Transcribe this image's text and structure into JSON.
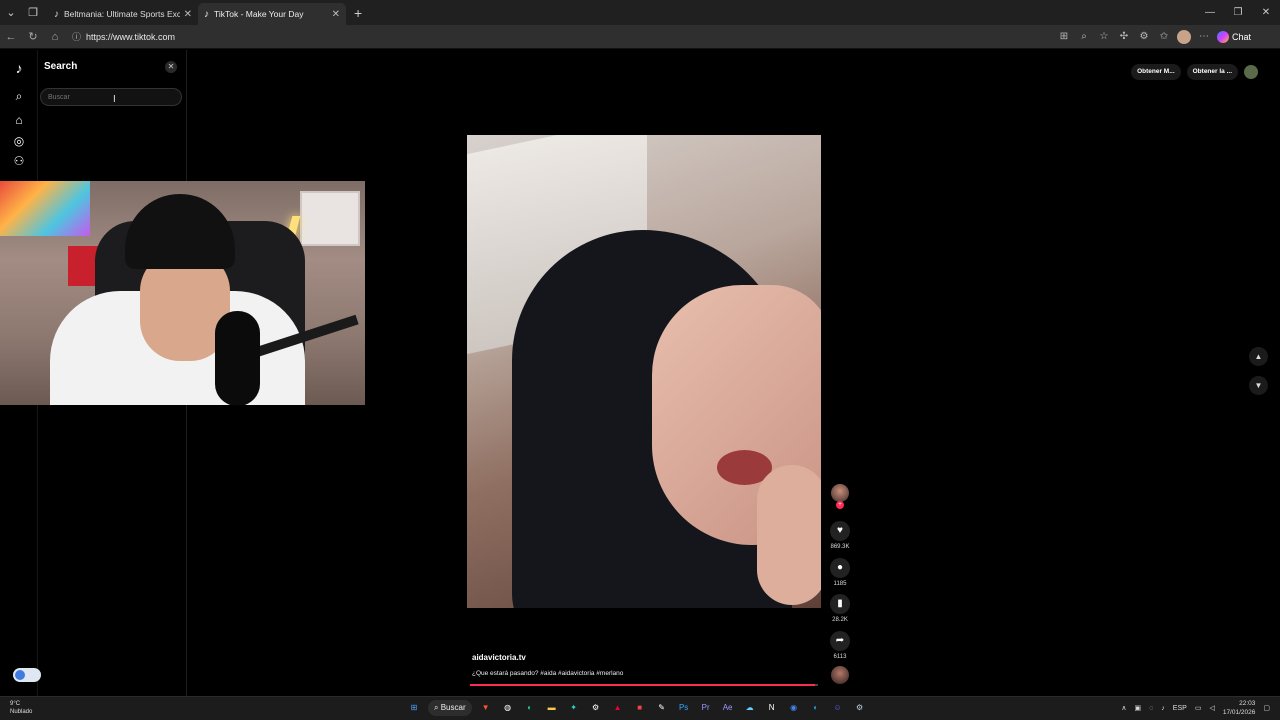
{
  "browser": {
    "tabs": [
      {
        "title": "Beltmania: Ultimate Sports Excitem",
        "icon": "tiktok-icon"
      },
      {
        "title": "TikTok - Make Your Day",
        "icon": "tiktok-icon"
      }
    ],
    "new_tab_glyph": "+",
    "url": "https://www.tiktok.com",
    "chat_label": "Chat"
  },
  "sidebar": {
    "search_title": "Search",
    "search_placeholder": "Buscar"
  },
  "header": {
    "get_app_label": "Obtener M...",
    "get_desktop_label": "Obtener la ..."
  },
  "video": {
    "username": "aidavictoria.tv",
    "caption": "¿Que estará pasando? #aida #aidavictoria #merlano",
    "likes": "869.3K",
    "comments": "1185",
    "saves": "28.2K",
    "shares": "6113",
    "progress": 0.99
  },
  "taskbar": {
    "weather_temp": "9°C",
    "weather_desc": "Nublado",
    "search_label": "Buscar",
    "lang": "ESP",
    "time": "22:03",
    "date": "17/01/2026"
  },
  "colors": {
    "tiktok_red": "#fe2c55",
    "background": "#000000"
  }
}
